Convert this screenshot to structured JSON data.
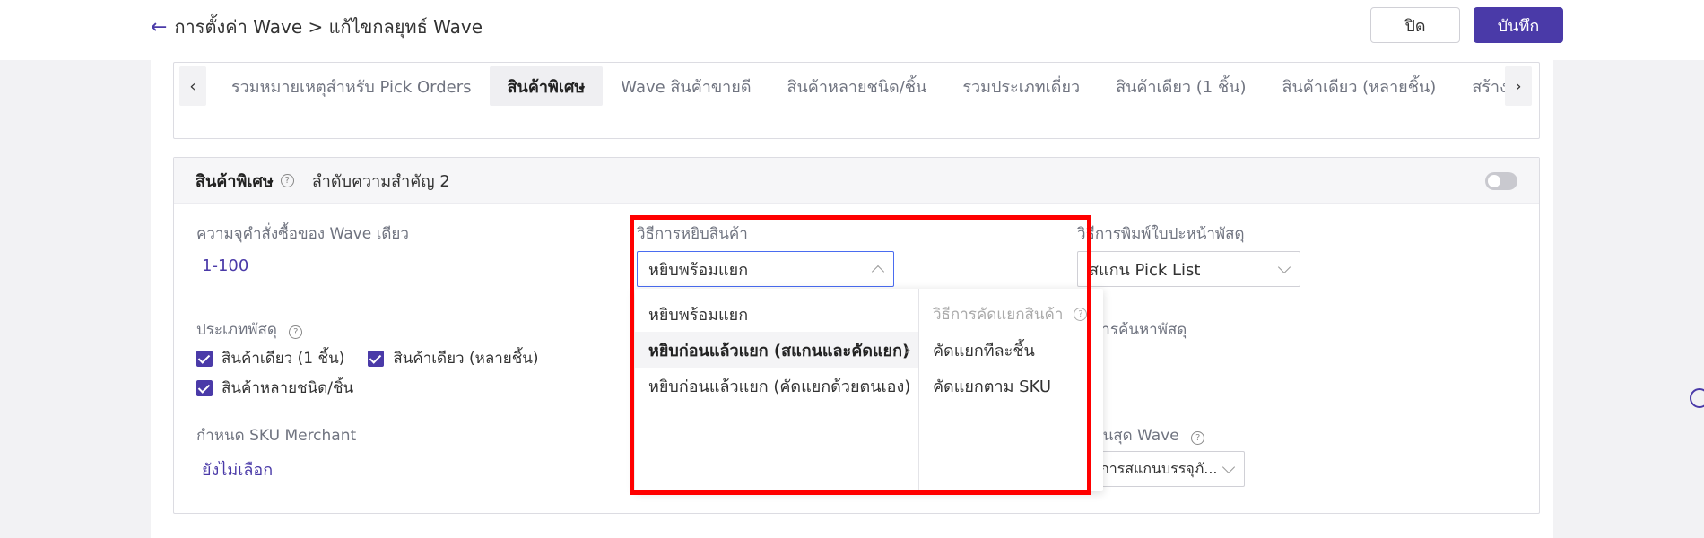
{
  "header": {
    "breadcrumb": "การตั้งค่า Wave > แก้ไขกลยุทธ์ Wave",
    "back_icon": "arrow-left-icon",
    "close_label": "ปิด",
    "save_label": "บันทึก"
  },
  "tabs": {
    "items": [
      {
        "label": "รวมหมายเหตุสำหรับ Pick Orders"
      },
      {
        "label": "สินค้าพิเศษ"
      },
      {
        "label": "Wave สินค้าขายดี"
      },
      {
        "label": "สินค้าหลายชนิด/ชิ้น"
      },
      {
        "label": "รวมประเภทเดี่ยว"
      },
      {
        "label": "สินค้าเดียว (1 ชิ้น)"
      },
      {
        "label": "สินค้าเดียว (หลายชิ้น)"
      },
      {
        "label": "สร้างด้วยตนเอง"
      }
    ],
    "active_index": 1
  },
  "rule": {
    "title": "สินค้าพิเศษ",
    "priority": "ลำดับความสำคัญ 2",
    "order_capacity_label": "ความจุคำสั่งซื้อของ Wave เดียว",
    "order_capacity_value": "1-100",
    "pick_method_label": "วิธีการหยิบสินค้า",
    "pick_method_value": "หยิบพร้อมแยก",
    "print_method_label": "วิธีการพิมพ์ใบปะหน้าพัสดุ",
    "print_method_value": "สแกน Pick List",
    "package_type_label": "ประเภทพัสดุ",
    "package_types": [
      "สินค้าเดียว (1 ชิ้น)",
      "สินค้าเดียว (หลายชิ้น)",
      "สินค้าหลายชนิด/ชิ้น"
    ],
    "search_label_partial": "การค้นหาพัสดุ",
    "sku_label": "กำหนด SKU Merchant",
    "sku_value": "ยังไม่เลือก",
    "end_wave_label_partial": "ฉิ้นสุด Wave",
    "end_wave_value_partial": "การสแกนบรรจุภั..."
  },
  "dropdown": {
    "options": [
      {
        "label": "หยิบพร้อมแยก"
      },
      {
        "label": "หยิบก่อนแล้วแยก (สแกนและคัดแยก)"
      },
      {
        "label": "หยิบก่อนแล้วแยก (คัดแยกด้วยตนเอง)"
      }
    ],
    "selected_index": 1,
    "sub_header": "วิธีการคัดแยกสินค้า",
    "sub_options": [
      {
        "label": "คัดแยกทีละชิ้น"
      },
      {
        "label": "คัดแยกตาม SKU"
      }
    ]
  },
  "colors": {
    "accent": "#4a3aa8",
    "highlight_box": "#ff0000"
  }
}
